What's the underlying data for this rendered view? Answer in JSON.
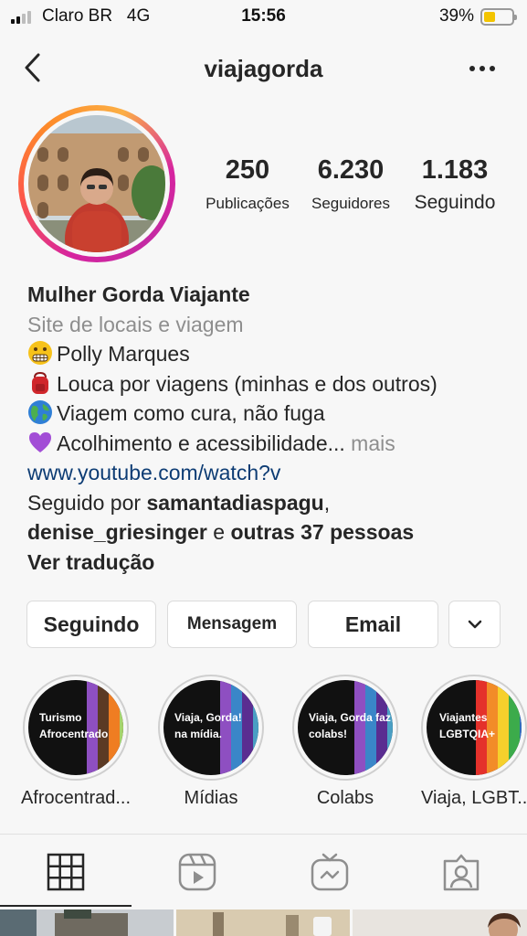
{
  "status": {
    "carrier": "Claro BR   4G",
    "time": "15:56",
    "battery_pct": "39%",
    "battery_level": 0.39,
    "signal_bars": 2
  },
  "header": {
    "username": "viajagorda",
    "back_icon": "chevron-left-icon",
    "more_icon": "ellipsis-icon"
  },
  "stats": [
    {
      "value": "250",
      "label": "Publicações"
    },
    {
      "value": "6.230",
      "label": "Seguidores"
    },
    {
      "value": "1.183",
      "label": "Seguindo"
    }
  ],
  "bio": {
    "name": "Mulher Gorda Viajante",
    "category": "Site de locais e viagem",
    "lines": [
      {
        "emoji": "grimacing-face-icon",
        "text": "Polly Marques"
      },
      {
        "emoji": "backpack-icon",
        "text": "Louca por viagens (minhas e dos outros)"
      },
      {
        "emoji": "globe-icon",
        "text": "Viagem como cura, não fuga"
      },
      {
        "emoji": "purple-heart-icon",
        "text": "Acolhimento e acessibilidade..."
      }
    ],
    "more": " mais",
    "link": "www.youtube.com/watch?v",
    "followed_prefix": "Seguido por ",
    "followed_user1": "samantadiaspagu",
    "followed_sep": ",",
    "followed_user2": "denise_griesinger",
    "followed_and": " e ",
    "followed_others": "outras 37 pessoas",
    "translate": "Ver tradução"
  },
  "buttons": {
    "following": "Seguindo",
    "message": "Mensagem",
    "email": "Email",
    "dropdown_icon": "chevron-down-icon"
  },
  "highlights": [
    {
      "text": "Turismo Afrocentrado",
      "caption": "Afrocentrad..."
    },
    {
      "text": "Viaja, Gorda! na mídia.",
      "caption": "Mídias"
    },
    {
      "text": "Viaja, Gorda faz colabs!",
      "caption": "Colabs"
    },
    {
      "text": "Viajantes LGBTQIA+",
      "caption": "Viaja, LGBT..."
    }
  ],
  "tabs": [
    "grid-icon",
    "reels-icon",
    "igtv-icon",
    "tagged-icon"
  ],
  "colors": {
    "text": "#262626",
    "muted": "#8e8e8e",
    "link": "#0d3c74",
    "border": "#dbdbdb",
    "background": "#f7f7f7"
  }
}
